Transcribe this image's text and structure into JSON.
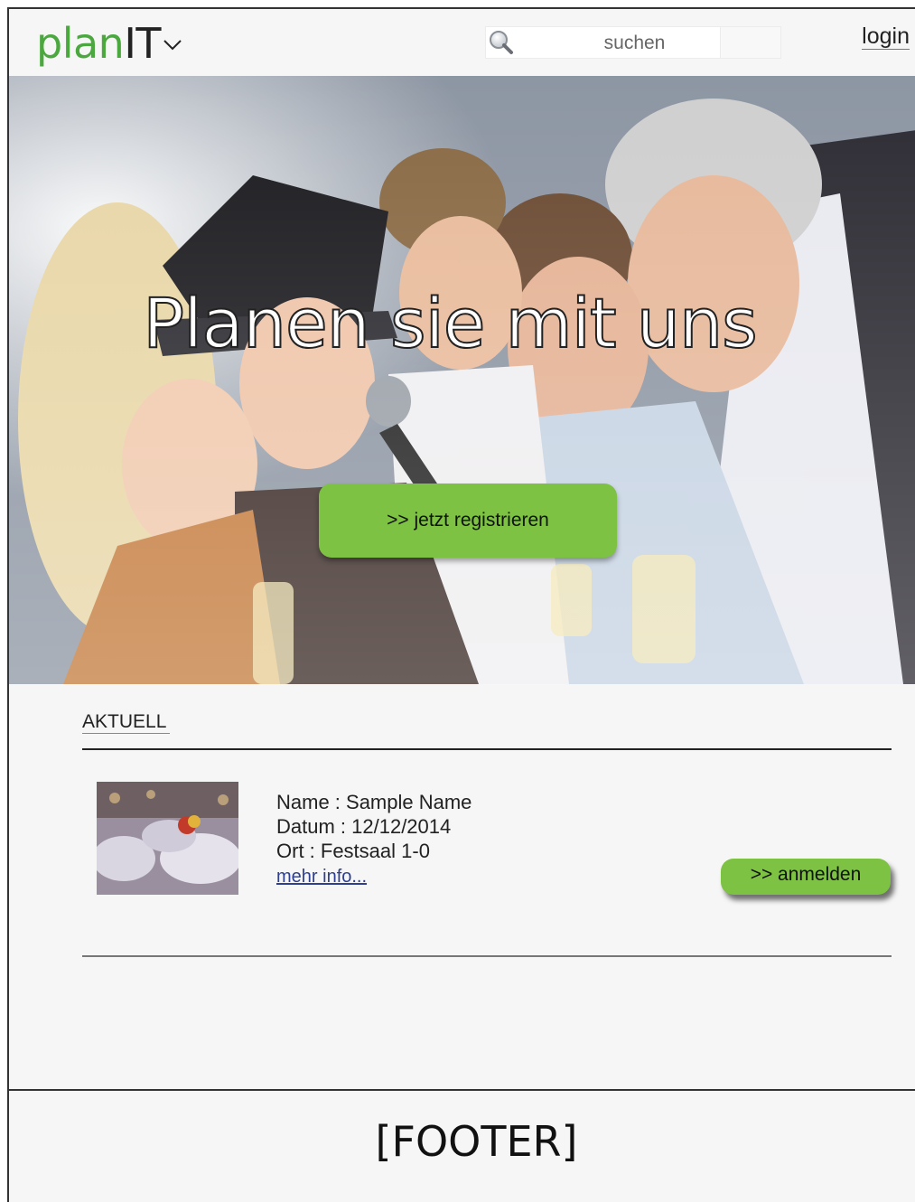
{
  "header": {
    "logo_plan": "plan",
    "logo_it": "IT",
    "search_placeholder": "suchen",
    "login_label": "login"
  },
  "hero": {
    "title": "Planen sie mit uns",
    "register_label": ">> jetzt registrieren"
  },
  "aktuell": {
    "section_title": "AKTUELL",
    "event": {
      "name": "Name : Sample Name",
      "date": "Datum : 12/12/2014",
      "location": "Ort : Festsaal 1-0",
      "more_link": "mehr info...",
      "signup_label": ">> anmelden"
    }
  },
  "footer": {
    "text": "[FOOTER]"
  },
  "colors": {
    "accent": "#7dc242",
    "logo_green": "#4aa83e"
  }
}
